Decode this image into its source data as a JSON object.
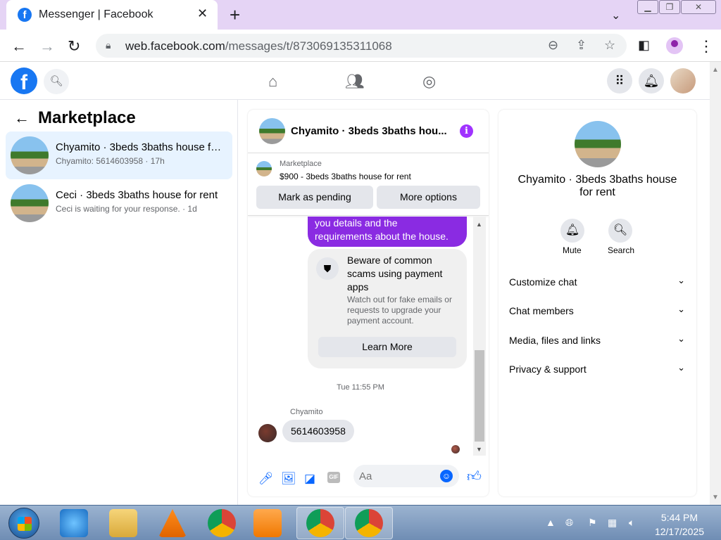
{
  "browser": {
    "tab_title": "Messenger | Facebook",
    "url_host": "web.facebook.com",
    "url_path": "/messages/t/873069135311068"
  },
  "left": {
    "header": "Marketplace",
    "conversations": [
      {
        "name": "Chyamito · 3beds 3baths house fo...",
        "sub": "Chyamito: 5614603958 · 17h"
      },
      {
        "name": "Ceci · 3beds 3baths house for rent",
        "sub": "Ceci is waiting for your response. · 1d"
      }
    ]
  },
  "chat": {
    "title": "Chyamito · 3beds 3baths hou...",
    "marketplace_label": "Marketplace",
    "marketplace_item": "$900 - 3beds 3baths house for rent",
    "btn_pending": "Mark as pending",
    "btn_more": "More options",
    "outgoing_tail_line1": "you details and the",
    "outgoing_tail_line2": "requirements about the house.",
    "warning_title": "Beware of common scams using payment apps",
    "warning_body": "Watch out for fake emails or requests to upgrade your payment account.",
    "learn_more": "Learn More",
    "timestamp": "Tue 11:55 PM",
    "sender": "Chyamito",
    "message": "5614603958",
    "input_placeholder": "Aa"
  },
  "details": {
    "title": "Chyamito · 3beds 3baths house for rent",
    "mute": "Mute",
    "search": "Search",
    "rows": [
      "Customize chat",
      "Chat members",
      "Media, files and links",
      "Privacy & support"
    ]
  },
  "taskbar": {
    "time": "5:44 PM",
    "date": "12/17/2025"
  },
  "colors": {
    "tabstrip": "#e5d4f5",
    "fb_blue": "#1877f2",
    "messenger_purple": "#8a2be2",
    "active_conv": "#e7f3ff"
  }
}
